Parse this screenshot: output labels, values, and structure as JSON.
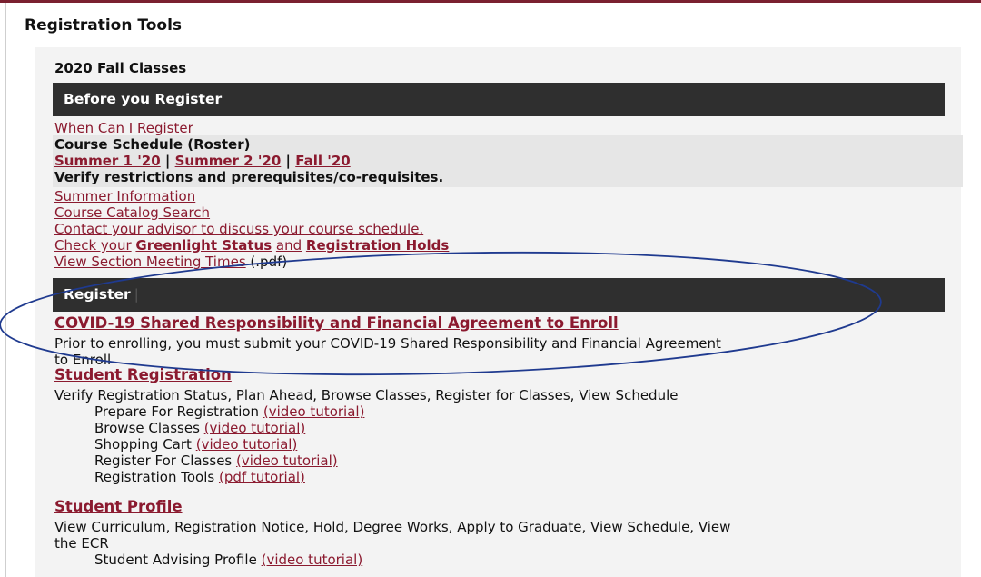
{
  "page": {
    "title": "Registration Tools"
  },
  "term": {
    "heading": "2020 Fall Classes"
  },
  "before_register": {
    "header": "Before you Register",
    "when_can_register": "When Can I Register",
    "course_schedule_label": "Course Schedule (Roster)",
    "terms": [
      "Summer 1 '20",
      "Summer 2 '20",
      "Fall '20"
    ],
    "separator": "|",
    "verify_note": "Verify restrictions and prerequisites/co-requisites.",
    "summer_info": "Summer Information",
    "catalog_search": "Course Catalog Search",
    "contact_advisor": "Contact your advisor to discuss your course schedule.",
    "check_prefix": "Check your",
    "greenlight": "Greenlight Status",
    "and_word": "and",
    "reg_holds": "Registration Holds",
    "meeting_times": "View Section Meeting Times",
    "meeting_times_suffix": "(.pdf)"
  },
  "register": {
    "header": "Register",
    "covid_link": "COVID-19 Shared Responsibility and Financial Agreement to Enroll",
    "covid_desc_line1": "Prior to enrolling, you must submit your COVID-19 Shared Responsibility and Financial Agreement",
    "covid_desc_line2": "to Enroll",
    "student_reg_link": "Student Registration",
    "student_reg_desc": "Verify Registration Status, Plan Ahead, Browse Classes, Register for Classes, View Schedule",
    "tools": [
      {
        "label": "Prepare For Registration",
        "tutorial": "(video tutorial)"
      },
      {
        "label": "Browse Classes",
        "tutorial": "(video tutorial)"
      },
      {
        "label": "Shopping Cart",
        "tutorial": "(video tutorial)"
      },
      {
        "label": "Register For Classes",
        "tutorial": "(video tutorial)"
      },
      {
        "label": "Registration Tools",
        "tutorial": "(pdf tutorial)"
      }
    ],
    "student_profile_link": "Student Profile",
    "student_profile_desc_line1": "View Curriculum, Registration Notice, Hold, Degree Works, Apply to Graduate, View Schedule, View",
    "student_profile_desc_line2": "the ECR",
    "advising_label": "Student Advising Profile",
    "advising_tutorial": "(video tutorial)"
  },
  "colors": {
    "link": "#8b1a2f",
    "bar": "#2f2f2f",
    "accent_rule": "#7a2030",
    "annotation_oval": "#1f3a8f"
  }
}
